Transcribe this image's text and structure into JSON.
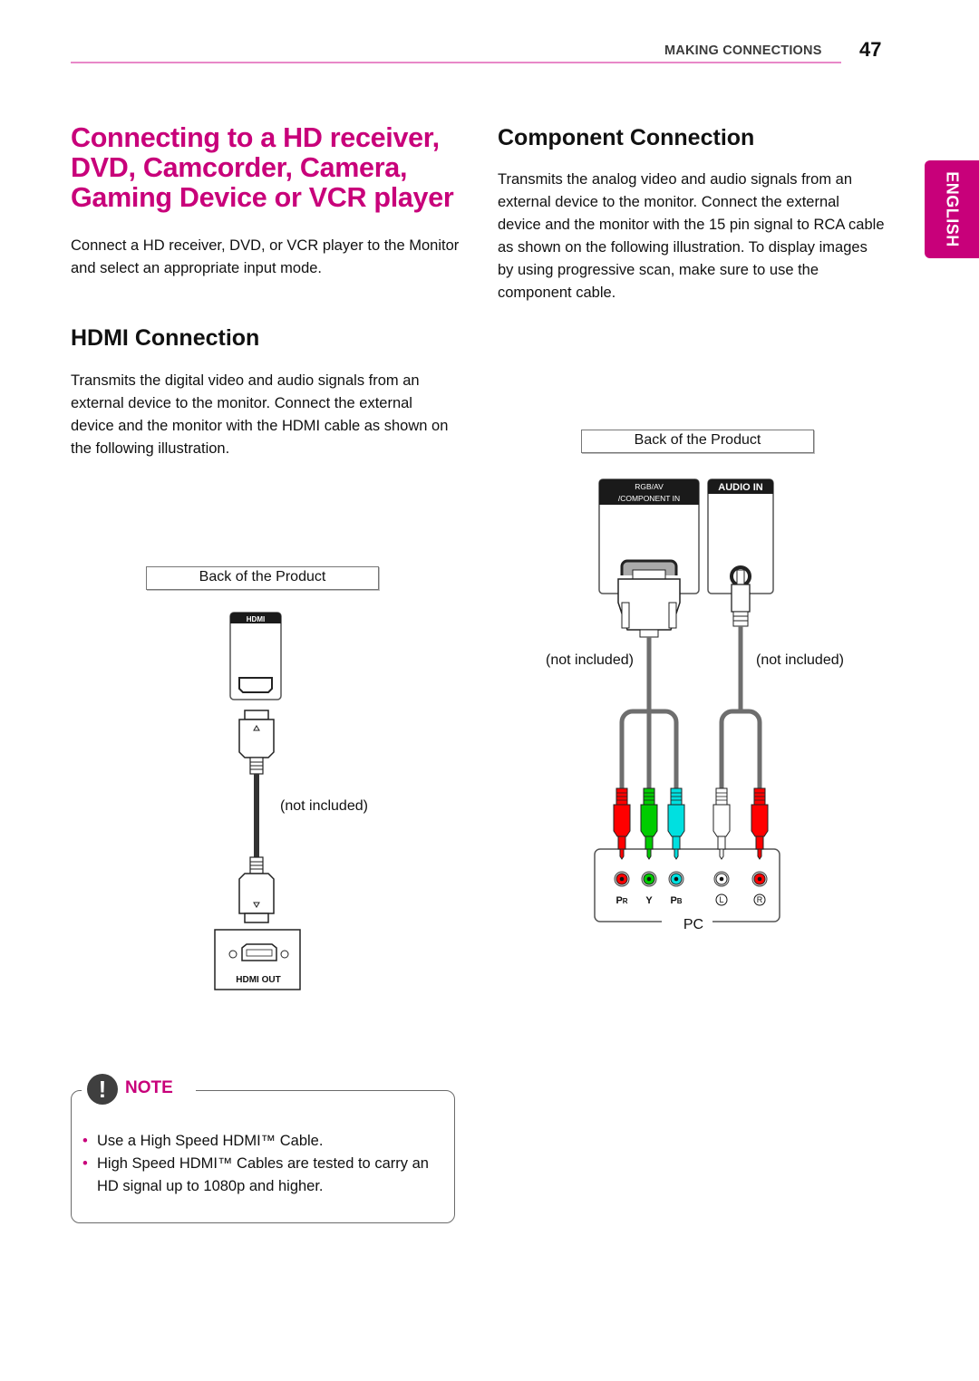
{
  "header": {
    "section": "MAKING CONNECTIONS",
    "page_number": "47"
  },
  "language_tab": "ENGLISH",
  "intro": {
    "title": "Connecting to a HD receiver, DVD, Camcorder, Camera, Gaming Device or VCR player",
    "body": "Connect a HD receiver, DVD, or VCR player to the Monitor and select an appropriate input mode."
  },
  "hdmi": {
    "heading": "HDMI Connection",
    "body": "Transmits the digital video and audio signals from an external device to the monitor. Connect the external device and the monitor with the HDMI cable as shown on the following illustration.",
    "diagram": {
      "back_label": "Back of the Product",
      "port_label": "HDMI",
      "cable_note": "(not included)",
      "device_port_label": "HDMI OUT"
    }
  },
  "component": {
    "heading": "Component Connection",
    "body": "Transmits the analog video and audio signals from an external device to the monitor. Connect the external device and the monitor with the 15 pin signal to RCA cable as shown on the following illustration. To display images by using progressive scan, make sure to use the component cable.",
    "diagram": {
      "back_label": "Back of the Product",
      "port1_label_line1": "RGB/AV",
      "port1_label_line2": "/COMPONENT IN",
      "port2_label": "AUDIO IN",
      "cable_note_left": "(not included)",
      "cable_note_right": "(not included)",
      "device_label": "PC",
      "jacks": [
        {
          "label": "PR",
          "color": "#ff0000"
        },
        {
          "label": "Y",
          "color": "#00cc00"
        },
        {
          "label": "PB",
          "color": "#00e0e0"
        },
        {
          "label": "L",
          "color": "#ffffff"
        },
        {
          "label": "R",
          "color": "#ff0000"
        }
      ]
    }
  },
  "note": {
    "title": "NOTE",
    "icon": "exclamation-icon",
    "items": [
      "Use a High Speed HDMI™ Cable.",
      "High Speed HDMI™ Cables are tested to carry an HD signal up to 1080p and higher."
    ]
  },
  "colors": {
    "accent": "#c8007a",
    "header_rule": "#e888c8",
    "cable_gray": "#6e6e6e"
  }
}
